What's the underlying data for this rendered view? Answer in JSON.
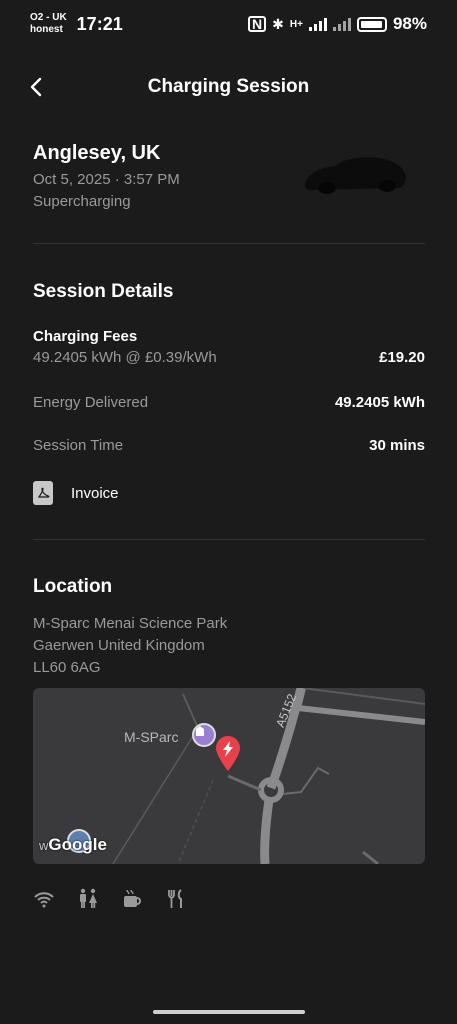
{
  "status_bar": {
    "carrier_line1": "O2 - UK",
    "carrier_line2": "honest",
    "time": "17:21",
    "network": "H+",
    "battery_percent": "98%",
    "battery_level": 0.98
  },
  "nav": {
    "back_icon": "chevron-left-icon",
    "title": "Charging Session"
  },
  "summary": {
    "location": "Anglesey, UK",
    "datetime": "Oct 5, 2025 · 3:57 PM",
    "type": "Supercharging"
  },
  "session_details": {
    "title": "Session Details",
    "fees_title": "Charging Fees",
    "fees_rate": "49.2405 kWh @ £0.39/kWh",
    "fees_total": "£19.20",
    "energy_label": "Energy Delivered",
    "energy_value": "49.2405 kWh",
    "time_label": "Session Time",
    "time_value": "30 mins",
    "invoice_label": "Invoice",
    "invoice_icon": "pdf-icon"
  },
  "location": {
    "title": "Location",
    "address_line1": "M-Sparc Menai Science Park",
    "address_line2": "Gaerwen United Kingdom",
    "address_line3": "LL60 6AG",
    "map_place_label": "M-SParc",
    "map_road_label": "A5152",
    "map_attribution": "Google",
    "map_attribution_prefix": "w"
  },
  "amenities": [
    "wifi-icon",
    "restrooms-icon",
    "coffee-icon",
    "restaurant-icon"
  ],
  "colors": {
    "background": "#1b1b1c",
    "secondary_text": "#9a9a9b",
    "divider": "#333335",
    "map_background": "#3a3a3c",
    "map_pin": "#e8414a",
    "place_marker": "#9a7fd0"
  }
}
